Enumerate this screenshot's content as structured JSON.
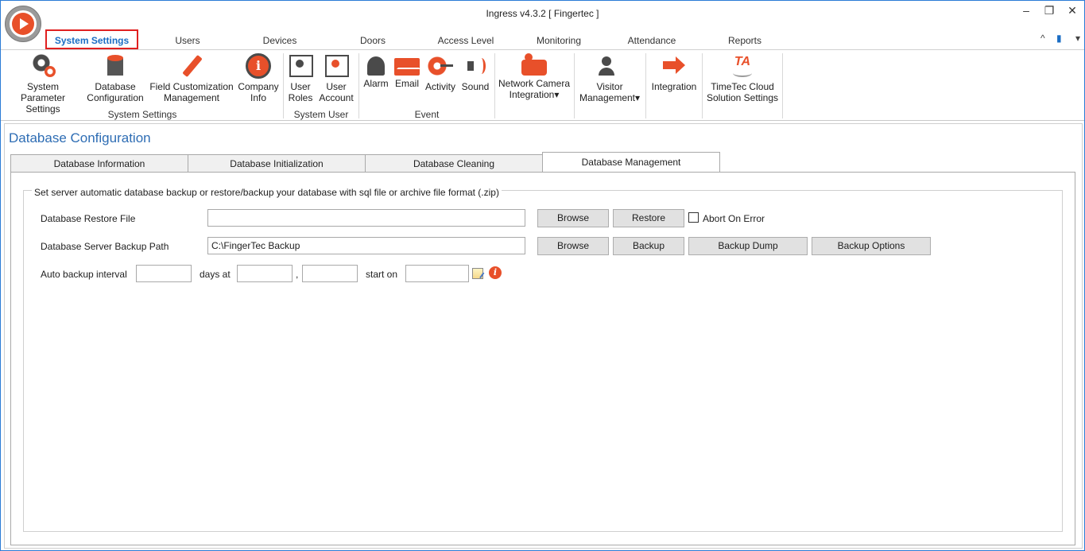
{
  "window": {
    "title": "Ingress v4.3.2 [ Fingertec ]",
    "controls": [
      "–",
      "❐",
      "✕"
    ]
  },
  "ribbon_tabs": [
    "System Settings",
    "Users",
    "Devices",
    "Doors",
    "Access Level",
    "Monitoring",
    "Attendance",
    "Reports"
  ],
  "ribbon_tab_active": "System Settings",
  "ribbon_right": {
    "collapse": "^",
    "office": "▮",
    "dropdown": "▾"
  },
  "ribbon": {
    "buttons": [
      {
        "label1": "System Parameter",
        "label2": "Settings",
        "icon": "gear-icon"
      },
      {
        "label1": "Database",
        "label2": "Configuration",
        "icon": "database-icon"
      },
      {
        "label1": "Field Customization",
        "label2": "Management",
        "icon": "pencil-icon"
      },
      {
        "label1": "Company",
        "label2": "Info",
        "icon": "info-icon"
      },
      {
        "label1": "User",
        "label2": "Roles",
        "icon": "user-roles-icon"
      },
      {
        "label1": "User",
        "label2": "Account",
        "icon": "user-account-icon"
      },
      {
        "label1": "Alarm",
        "label2": "",
        "icon": "bell-icon"
      },
      {
        "label1": "Email",
        "label2": "",
        "icon": "mail-icon"
      },
      {
        "label1": "Activity",
        "label2": "",
        "icon": "activity-icon"
      },
      {
        "label1": "Sound",
        "label2": "",
        "icon": "sound-icon"
      },
      {
        "label1": "Network Camera",
        "label2": "Integration▾",
        "icon": "camera-icon"
      },
      {
        "label1": "Visitor",
        "label2": "Management▾",
        "icon": "visitor-icon"
      },
      {
        "label1": "Integration",
        "label2": "",
        "icon": "integration-icon"
      },
      {
        "label1": "TimeTec Cloud",
        "label2": "Solution Settings",
        "icon": "timetec-icon",
        "icon_text": "TA"
      }
    ],
    "groups": [
      "System Settings",
      "System User",
      "Event"
    ]
  },
  "page": {
    "title": "Database Configuration",
    "tabs": [
      "Database Information",
      "Database Initialization",
      "Database Cleaning",
      "Database Management"
    ],
    "active_tab": "Database Management",
    "group_legend": "Set server automatic database backup or restore/backup your database with sql file or archive file format (.zip)",
    "restore": {
      "label": "Database Restore File",
      "value": "",
      "browse": "Browse",
      "restore_btn": "Restore",
      "abort_label": "Abort On Error",
      "abort_checked": false
    },
    "backup": {
      "label": "Database Server Backup Path",
      "value": "C:\\FingerTec Backup",
      "browse": "Browse",
      "backup_btn": "Backup",
      "dump_btn": "Backup Dump",
      "options_btn": "Backup Options"
    },
    "auto": {
      "label": "Auto backup interval",
      "interval": "",
      "days_at": "days at",
      "hour": "",
      "comma": ",",
      "minute": "",
      "start_on": "start on",
      "start_date": ""
    }
  }
}
